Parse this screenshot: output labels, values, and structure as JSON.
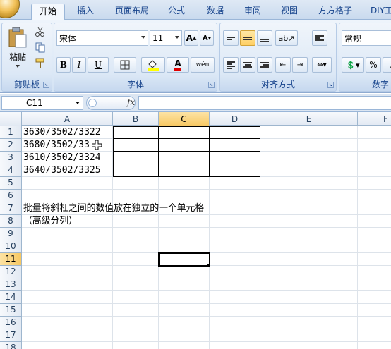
{
  "tabs": [
    "开始",
    "插入",
    "页面布局",
    "公式",
    "数据",
    "审阅",
    "视图",
    "方方格子",
    "DIY工"
  ],
  "ribbon": {
    "clipboard": {
      "title": "剪贴板",
      "paste_label": "粘贴"
    },
    "font": {
      "title": "字体",
      "font_name": "宋体",
      "font_size": "11",
      "bold": "B",
      "italic": "I",
      "underline": "U",
      "grow": "A",
      "shrink": "A",
      "font_color_glyph": "A",
      "phonetic": "wén"
    },
    "alignment": {
      "title": "对齐方式"
    },
    "number": {
      "title": "数字",
      "format": "常规",
      "percent": "%"
    }
  },
  "formula_bar": {
    "name_box": "C11",
    "fx": "fx",
    "formula": ""
  },
  "columns": [
    "A",
    "B",
    "C",
    "D",
    "E",
    "F"
  ],
  "selected_column": "C",
  "rows": [
    "1",
    "2",
    "3",
    "4",
    "5",
    "6",
    "7",
    "8",
    "9",
    "10",
    "11",
    "12",
    "13",
    "14",
    "15",
    "16",
    "17",
    "18"
  ],
  "selected_row": "11",
  "cells": {
    "A1": "3630/3502/3322",
    "A2": "3680/3502/33",
    "A3": "3610/3502/3324",
    "A4": "3640/3502/3325",
    "A7": "批量将斜杠之间的数值放在独立的一个单元格",
    "A8": "（高级分列）"
  },
  "active_cell": "C11",
  "colors": {
    "accent": "#15428b",
    "selected_header": "#f7c862",
    "gridline": "#dde3ea"
  }
}
